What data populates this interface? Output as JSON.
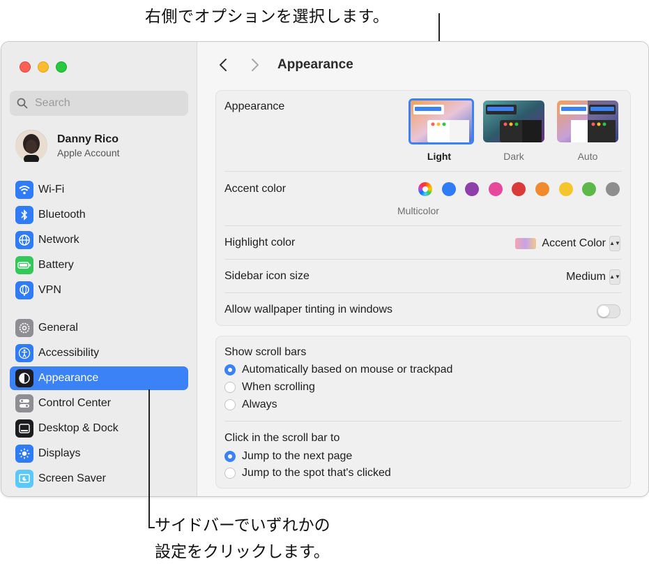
{
  "callouts": {
    "top": "右側でオプションを選択します。",
    "bottom_line1": "サイドバーでいずれかの",
    "bottom_line2": "設定をクリックします。"
  },
  "sidebar": {
    "search_placeholder": "Search",
    "account": {
      "name": "Danny Rico",
      "subtitle": "Apple Account"
    },
    "items": [
      {
        "label": "Wi-Fi",
        "icon": "wifi-icon",
        "color": "#2f7cf6"
      },
      {
        "label": "Bluetooth",
        "icon": "bluetooth-icon",
        "color": "#2f7cf6"
      },
      {
        "label": "Network",
        "icon": "globe-icon",
        "color": "#2f7cf6"
      },
      {
        "label": "Battery",
        "icon": "battery-icon",
        "color": "#34c759"
      },
      {
        "label": "VPN",
        "icon": "vpn-globe-icon",
        "color": "#2f7cf6"
      },
      {
        "label": "General",
        "icon": "gear-icon",
        "color": "#8e8e93"
      },
      {
        "label": "Accessibility",
        "icon": "accessibility-icon",
        "color": "#2f7cf6"
      },
      {
        "label": "Appearance",
        "icon": "appearance-icon",
        "color": "#1d1d1f",
        "selected": true
      },
      {
        "label": "Control Center",
        "icon": "control-center-icon",
        "color": "#8e8e93"
      },
      {
        "label": "Desktop & Dock",
        "icon": "desktop-dock-icon",
        "color": "#1d1d1f"
      },
      {
        "label": "Displays",
        "icon": "sun-icon",
        "color": "#2f7cf6"
      },
      {
        "label": "Screen Saver",
        "icon": "screen-saver-icon",
        "color": "#5ac8fa"
      }
    ]
  },
  "header": {
    "title": "Appearance"
  },
  "appearance": {
    "label": "Appearance",
    "options": [
      {
        "label": "Light",
        "selected": true
      },
      {
        "label": "Dark",
        "selected": false
      },
      {
        "label": "Auto",
        "selected": false
      }
    ]
  },
  "accent": {
    "label": "Accent color",
    "selected_label": "Multicolor",
    "colors": [
      "multicolor",
      "#2f7cf6",
      "#8e3fa8",
      "#e6499b",
      "#d93a3a",
      "#f08a2c",
      "#f5c62b",
      "#5cb848",
      "#8e8e8e"
    ]
  },
  "highlight": {
    "label": "Highlight color",
    "value": "Accent Color"
  },
  "sidebar_icon_size": {
    "label": "Sidebar icon size",
    "value": "Medium"
  },
  "wallpaper_tinting": {
    "label": "Allow wallpaper tinting in windows",
    "enabled": false
  },
  "scroll_bars": {
    "label": "Show scroll bars",
    "options": [
      {
        "label": "Automatically based on mouse or trackpad",
        "selected": true
      },
      {
        "label": "When scrolling",
        "selected": false
      },
      {
        "label": "Always",
        "selected": false
      }
    ]
  },
  "click_scroll": {
    "label": "Click in the scroll bar to",
    "options": [
      {
        "label": "Jump to the next page",
        "selected": true
      },
      {
        "label": "Jump to the spot that's clicked",
        "selected": false
      }
    ]
  }
}
